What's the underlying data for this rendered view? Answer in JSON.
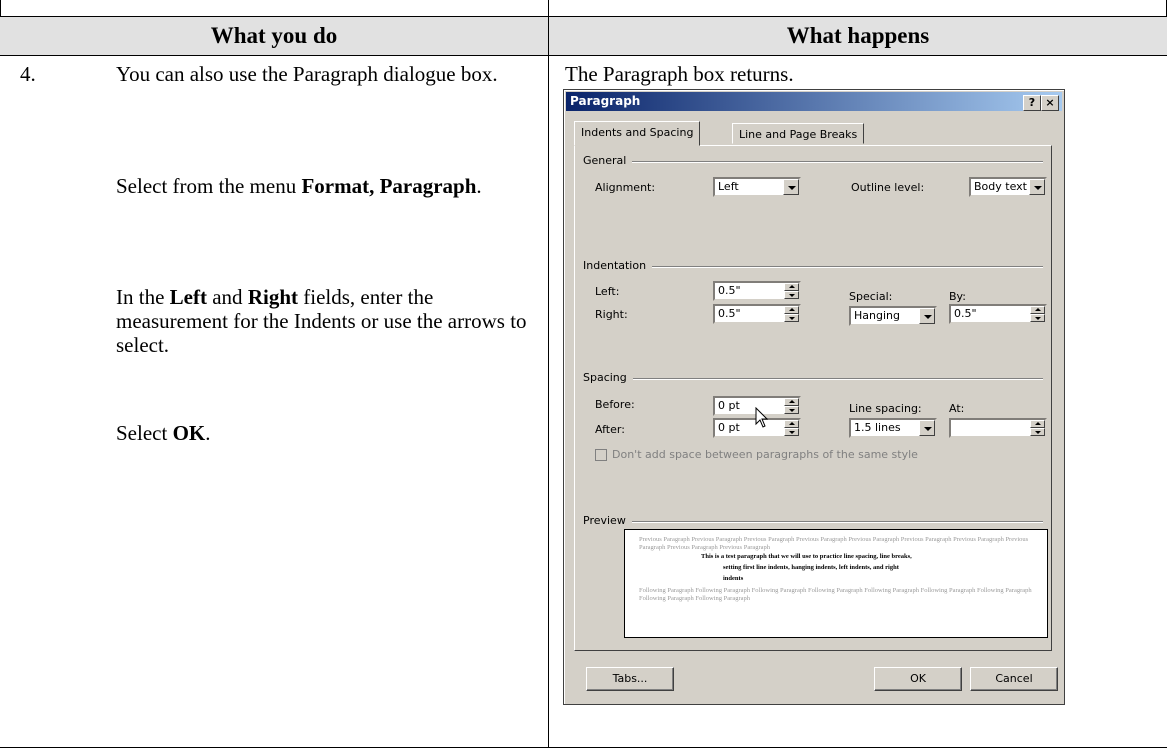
{
  "table": {
    "header_left": "What you do",
    "header_right": "What happens"
  },
  "step": {
    "number": "4.",
    "line1": "You can also use the Paragraph dialogue box.",
    "line2_prefix": "Select from the menu ",
    "line2_bold": "Format, Paragraph",
    "line2_suffix": ".",
    "line3_in": "In the ",
    "line3_left": "Left",
    "line3_and": " and ",
    "line3_right": "Right",
    "line3_rest": " fields, enter the measurement for the Indents or use the arrows to select.",
    "line4_prefix": "Select ",
    "line4_bold": "OK",
    "line4_suffix": "."
  },
  "result_text": "The Paragraph box returns.",
  "dialog": {
    "title": "Paragraph",
    "help_btn": "?",
    "close_btn": "×",
    "tabs": [
      "Indents and Spacing",
      "Line and Page Breaks"
    ],
    "general": {
      "group": "General",
      "alignment_label": "Alignment:",
      "alignment_value": "Left",
      "outline_label": "Outline level:",
      "outline_value": "Body text"
    },
    "indentation": {
      "group": "Indentation",
      "left_label": "Left:",
      "left_value": "0.5\"",
      "right_label": "Right:",
      "right_value": "0.5\"",
      "special_label": "Special:",
      "special_value": "Hanging",
      "by_label": "By:",
      "by_value": "0.5\""
    },
    "spacing": {
      "group": "Spacing",
      "before_label": "Before:",
      "before_value": "0 pt",
      "after_label": "After:",
      "after_value": "0 pt",
      "line_spacing_label": "Line spacing:",
      "line_spacing_value": "1.5 lines",
      "at_label": "At:",
      "at_value": "",
      "no_space_label": "Don't add space between paragraphs of the same style"
    },
    "preview": {
      "group": "Preview",
      "previous": "Previous Paragraph Previous Paragraph Previous Paragraph Previous Paragraph Previous Paragraph Previous Paragraph Previous Paragraph Previous Paragraph Previous Paragraph Previous Paragraph",
      "sample1": "This is a test paragraph that we will use to practice line spacing, line breaks,",
      "sample2": "setting first line indents, hanging indents, left indents, and right",
      "sample3": "indents",
      "following": "Following Paragraph Following Paragraph Following Paragraph Following Paragraph Following Paragraph Following Paragraph Following Paragraph Following Paragraph Following Paragraph"
    },
    "buttons": {
      "tabs": "Tabs...",
      "ok": "OK",
      "cancel": "Cancel"
    }
  }
}
